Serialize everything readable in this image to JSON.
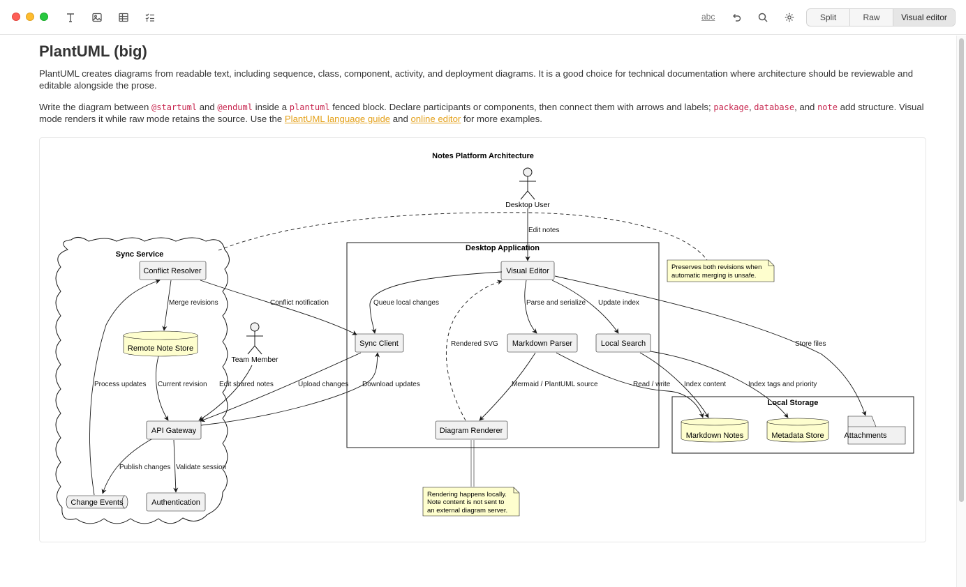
{
  "toolbar": {
    "icons": [
      "text-format-icon",
      "image-icon",
      "table-icon",
      "checklist-icon"
    ],
    "spellcheck_label": "abc",
    "view_modes": [
      "Split",
      "Raw",
      "Visual editor"
    ],
    "active_mode": "Visual editor"
  },
  "doc": {
    "title": "PlantUML (big)",
    "p1": "PlantUML creates diagrams from readable text, including sequence, class, component, activity, and deployment diagrams. It is a good choice for technical documentation where architecture should be reviewable and editable alongside the prose.",
    "p2": {
      "t1": "Write the diagram between ",
      "c1": "@startuml",
      "t2": " and ",
      "c2": "@enduml",
      "t3": " inside a ",
      "c3": "plantuml",
      "t4": " fenced block. Declare participants or components, then connect them with arrows and labels; ",
      "c4": "package",
      "t5": ", ",
      "c5": "database",
      "t6": ", and ",
      "c6": "note",
      "t7": " add structure. Visual mode renders it while raw mode retains the source. Use the ",
      "l1": "PlantUML language guide",
      "t8": " and ",
      "l2": "online editor",
      "t9": " for more examples."
    }
  },
  "diagram": {
    "title": "Notes Platform Architecture",
    "actors": {
      "desktop_user": "Desktop User",
      "team_member": "Team Member"
    },
    "containers": {
      "sync_service": "Sync Service",
      "desktop_app": "Desktop Application",
      "local_storage": "Local Storage"
    },
    "components": {
      "conflict_resolver": "Conflict Resolver",
      "remote_note_store": "Remote Note Store",
      "api_gateway": "API Gateway",
      "change_events": "Change Events",
      "authentication": "Authentication",
      "visual_editor": "Visual Editor",
      "sync_client": "Sync Client",
      "markdown_parser": "Markdown Parser",
      "local_search": "Local Search",
      "diagram_renderer": "Diagram Renderer",
      "markdown_notes": "Markdown Notes",
      "metadata_store": "Metadata Store",
      "attachments": "Attachments"
    },
    "edge_labels": {
      "edit_notes": "Edit notes",
      "merge_revisions": "Merge revisions",
      "conflict_notification": "Conflict notification",
      "queue_local_changes": "Queue local changes",
      "parse_and_serialize": "Parse and serialize",
      "update_index": "Update index",
      "store_files": "Store files",
      "rendered_svg": "Rendered SVG",
      "process_updates": "Process updates",
      "current_revision": "Current revision",
      "edit_shared_notes": "Edit shared notes",
      "upload_changes": "Upload changes",
      "download_updates": "Download updates",
      "mermaid_plantuml_source": "Mermaid / PlantUML source",
      "read_write": "Read / write",
      "index_content": "Index content",
      "index_tags_priority": "Index tags and priority",
      "publish_changes": "Publish changes",
      "validate_session": "Validate session"
    },
    "notes": {
      "merge_note": [
        "Preserves both revisions when",
        "automatic merging is unsafe."
      ],
      "render_note": [
        "Rendering happens locally.",
        "Note content is not sent to",
        "an external diagram server."
      ]
    }
  }
}
